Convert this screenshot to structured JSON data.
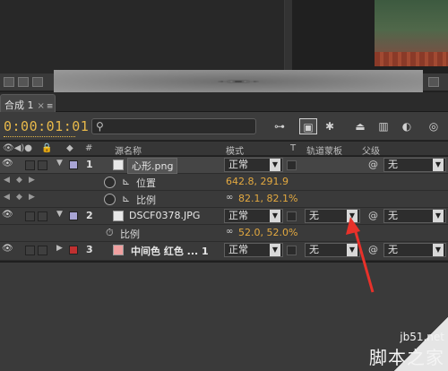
{
  "composition_tab": {
    "label": "合成 1",
    "close": "×",
    "menu": "≡"
  },
  "timecode": "0:00:01:01",
  "search": {
    "placeholder": ""
  },
  "columns": {
    "source_name": "源名称",
    "mode": "模式",
    "t": "T",
    "trkmat": "轨道蒙板",
    "parent": "父级",
    "hash": "#"
  },
  "layers": [
    {
      "num": "1",
      "name": "心形.png",
      "mode": "正常",
      "parent": "无",
      "label_color": "#a8a4d4"
    },
    {
      "num": "2",
      "name": "DSCF0378.JPG",
      "mode": "正常",
      "trkmat": "无",
      "parent": "无",
      "label_color": "#a8a4d4"
    },
    {
      "num": "3",
      "name": "中间色 红色 ... 1",
      "mode": "正常",
      "trkmat": "无",
      "parent": "无",
      "label_color": "#c03030"
    }
  ],
  "layer1_props": [
    {
      "name": "位置",
      "value": "642.8, 291.9"
    },
    {
      "name": "比例",
      "value": "82.1, 82.1%"
    }
  ],
  "layer2_props": [
    {
      "name": "比例",
      "value": "52.0, 52.0%"
    }
  ],
  "watermark": {
    "site": "jb51.net",
    "name": "脚本之家"
  },
  "colors": {
    "timecode": "#e7b84a",
    "value": "#e3a940",
    "arrow": "#e8312a"
  }
}
